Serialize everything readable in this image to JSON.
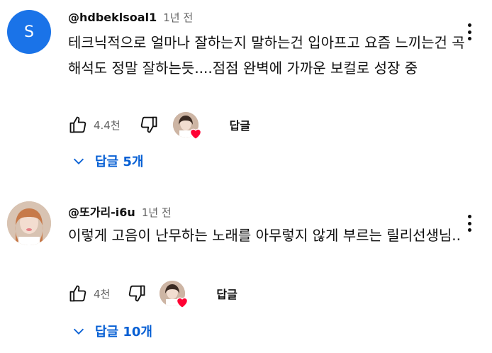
{
  "comments": [
    {
      "avatar_letter": "S",
      "avatar_color": "#1a73e8",
      "author": "@hdbeklsoal1",
      "time": "1년 전",
      "text": "테크닉적으로 얼마나 잘하는지 말하는건 입아프고 요즘 느끼는건 곡 해석도 정말 잘하는듯....점점 완벽에 가까운 보컬로 성장 중",
      "likes": "4.4천",
      "reply_label": "답글",
      "replies_label": "답글 5개"
    },
    {
      "author": "@또가리-i6u",
      "time": "1년 전",
      "text": "이렇게 고음이 난무하는 노래를 아무렇지 않게 부르는 릴리선생님..",
      "likes": "4천",
      "reply_label": "답글",
      "replies_label": "답글 10개"
    }
  ],
  "colors": {
    "link_blue": "#065fd4",
    "heart_red": "#ff0033",
    "secondary_text": "#606060"
  },
  "icons": [
    "thumb-up-icon",
    "thumb-down-icon",
    "creator-heart-icon",
    "chevron-down-icon",
    "more-vert-icon"
  ]
}
